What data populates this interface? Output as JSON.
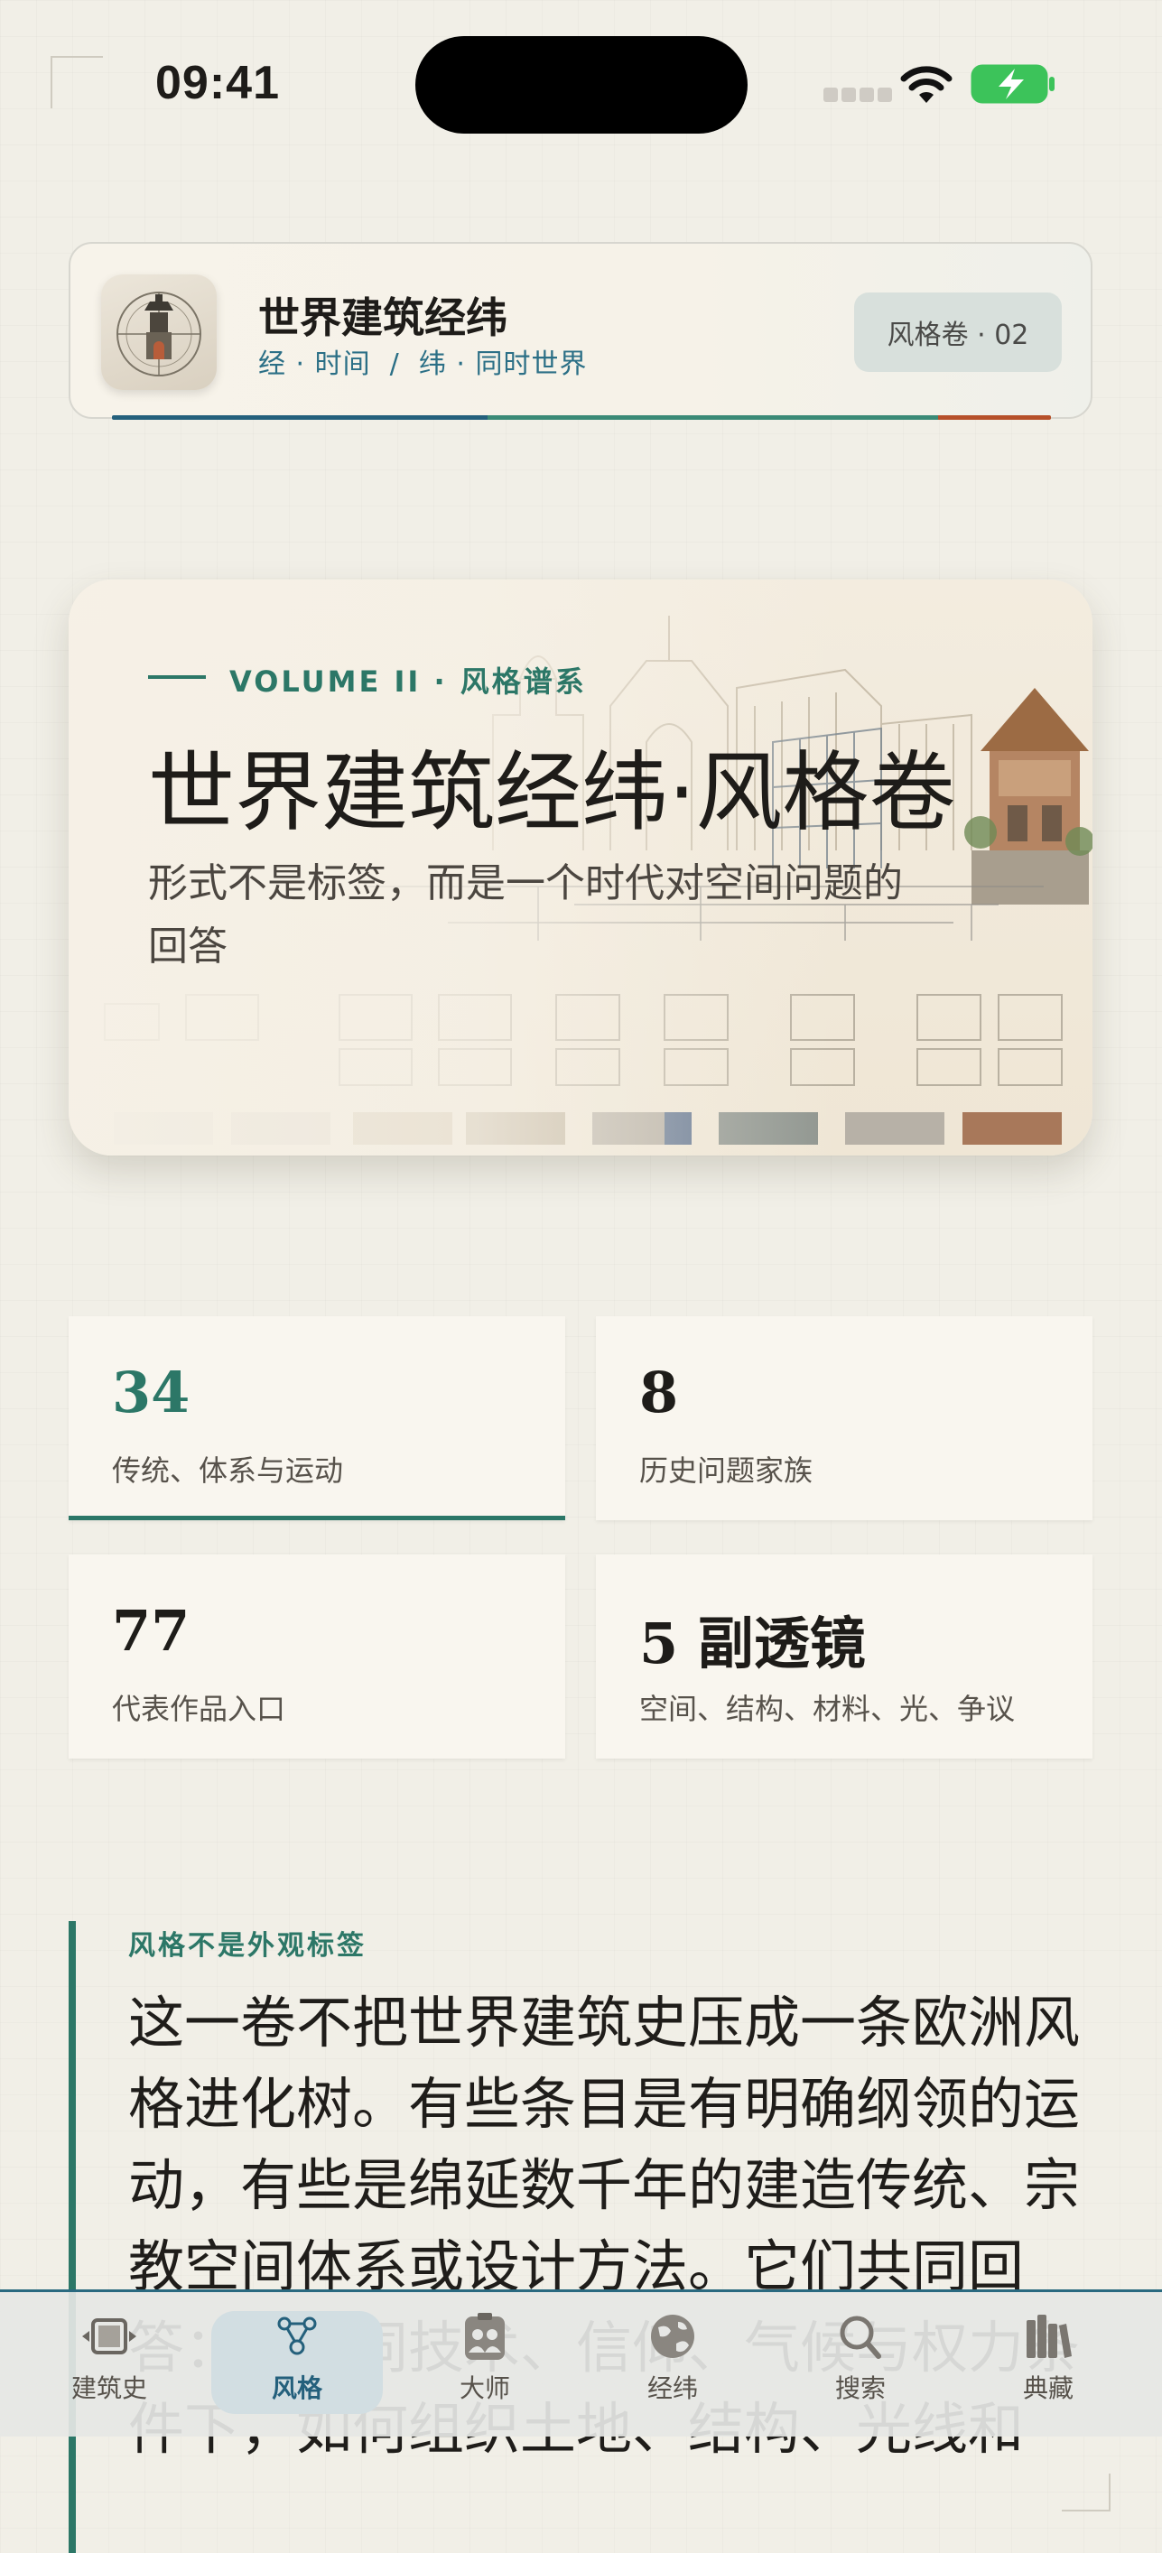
{
  "status_bar": {
    "time": "09:41"
  },
  "header": {
    "title": "世界建筑经纬",
    "subtitle": "经 · 时间  /  纬 · 同时世界",
    "volume_chip": "风格卷 · 02",
    "accent_colors": [
      "#24607c",
      "#3a8a76",
      "#b6502a"
    ]
  },
  "hero": {
    "eyebrow": "VOLUME II · 风格谱系",
    "title": "世界建筑经纬·风格卷",
    "description": "形式不是标签，而是一个时代对空间问题的回答"
  },
  "stats": [
    {
      "value": "34",
      "label": "传统、体系与运动",
      "active": true
    },
    {
      "value": "8",
      "label": "历史问题家族",
      "active": false
    },
    {
      "value": "77",
      "label": "代表作品入口",
      "active": false
    },
    {
      "value": "5 副透镜",
      "label": "空间、结构、材料、光、争议",
      "active": false
    }
  ],
  "article": {
    "eyebrow": "风格不是外观标签",
    "body": "这一卷不把世界建筑史压成一条欧洲风格进化树。有些条目是有明确纲领的运动，有些是绵延数千年的建造传统、宗教空间体系或设计方法。它们共同回答：在不同技术、信仰、气候与权力条件下，如何组织土地、结构、光线和"
  },
  "tabbar": {
    "items": [
      {
        "label": "建筑史",
        "icon": "film-strip-icon"
      },
      {
        "label": "风格",
        "icon": "network-nodes-icon",
        "active": true
      },
      {
        "label": "大师",
        "icon": "people-badge-icon"
      },
      {
        "label": "经纬",
        "icon": "globe-icon"
      },
      {
        "label": "搜索",
        "icon": "search-icon"
      },
      {
        "label": "典藏",
        "icon": "books-icon"
      }
    ],
    "accent": "#24607c"
  }
}
